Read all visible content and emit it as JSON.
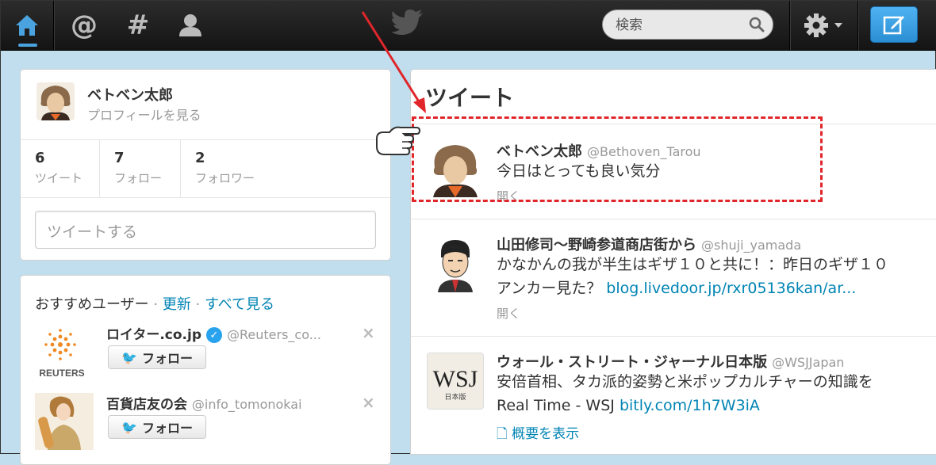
{
  "topbar": {
    "search_placeholder": "検索",
    "nav": [
      "home-icon",
      "mentions-icon",
      "hashtag-icon",
      "profile-icon"
    ]
  },
  "profile": {
    "name": "ベトベン太郎",
    "view_profile": "プロフィールを見る",
    "stats": [
      {
        "count": "6",
        "label": "ツイート"
      },
      {
        "count": "7",
        "label": "フォロー"
      },
      {
        "count": "2",
        "label": "フォロワー"
      }
    ],
    "compose_placeholder": "ツイートする"
  },
  "recommended": {
    "title": "おすすめユーザー",
    "refresh": "更新",
    "view_all": "すべて見る",
    "users": [
      {
        "name": "ロイター.co.jp",
        "handle": "@Reuters_co...",
        "follow": "フォロー",
        "avatar_text": "REUTERS",
        "verified": true
      },
      {
        "name": "百貨店友の会",
        "handle": "@info_tomonokai",
        "follow": "フォロー",
        "verified": false
      }
    ]
  },
  "timeline": {
    "title": "ツイート",
    "tweets": [
      {
        "name": "ベトベン太郎",
        "handle": "@Bethoven_Tarou",
        "text": "今日はとっても良い気分",
        "action": "開く"
      },
      {
        "name": "山田修司〜野崎参道商店街から",
        "handle": "@shuji_yamada",
        "text1": "かなかんの我が半生はギザ１０と共に！：昨日のギザ１０",
        "text2_plain": "アンカー見た？ ",
        "text2_link": "blog.livedoor.jp/rxr05136kan/ar...",
        "action": "開く"
      },
      {
        "name": "ウォール・ストリート・ジャーナル日本版",
        "handle": "@WSJJapan",
        "text1": "安倍首相、タカ派的姿勢と米ポップカルチャーの知識を",
        "text2_plain": "Real Time - WSJ ",
        "text2_link": "bitly.com/1h7W3iA",
        "action": "概要を表示",
        "avatar_text": "WSJ",
        "avatar_sub": "日本版"
      }
    ]
  },
  "colors": {
    "accent": "#0084b4",
    "highlight": "#e0262b",
    "topbar": "#1e1e1e"
  }
}
